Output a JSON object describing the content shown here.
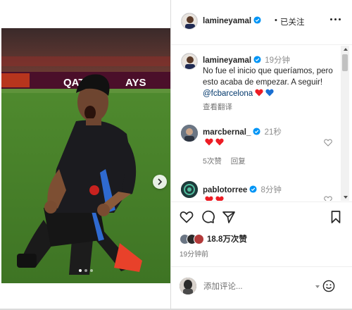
{
  "post": {
    "username": "lamineyamal",
    "header_separator": "•",
    "follow_status": "已关注",
    "caption": {
      "username": "lamineyamal",
      "time": "19分钟",
      "text": "No fue el inicio que queríamos, pero esto acaba de empezar. A seguir!",
      "mention": "@fcbarcelona",
      "translate_label": "查看翻译"
    },
    "comments": [
      {
        "username": "marcbernal_",
        "time": "21秒",
        "likes": "5次赞",
        "reply_label": "回复"
      },
      {
        "username": "pablotorree",
        "time": "8分钟"
      }
    ],
    "likes_count": "18.8万次赞",
    "timestamp": "19分钟前",
    "comment_placeholder": "添加评论...",
    "media": {
      "sponsor_text": "QATA",
      "sponsor_text_right": "AYS"
    }
  },
  "icons": {
    "verified": "verified-badge-icon",
    "more": "more-options-icon",
    "like": "heart-icon",
    "comment": "comment-icon",
    "share": "share-icon",
    "save": "bookmark-icon",
    "emoji": "emoji-icon",
    "next": "chevron-right-icon"
  },
  "colors": {
    "verified": "#0095f6",
    "mention": "#00376b",
    "heart_red": "#ed1c24",
    "heart_blue": "#1a6fd1",
    "muted": "#737373"
  }
}
